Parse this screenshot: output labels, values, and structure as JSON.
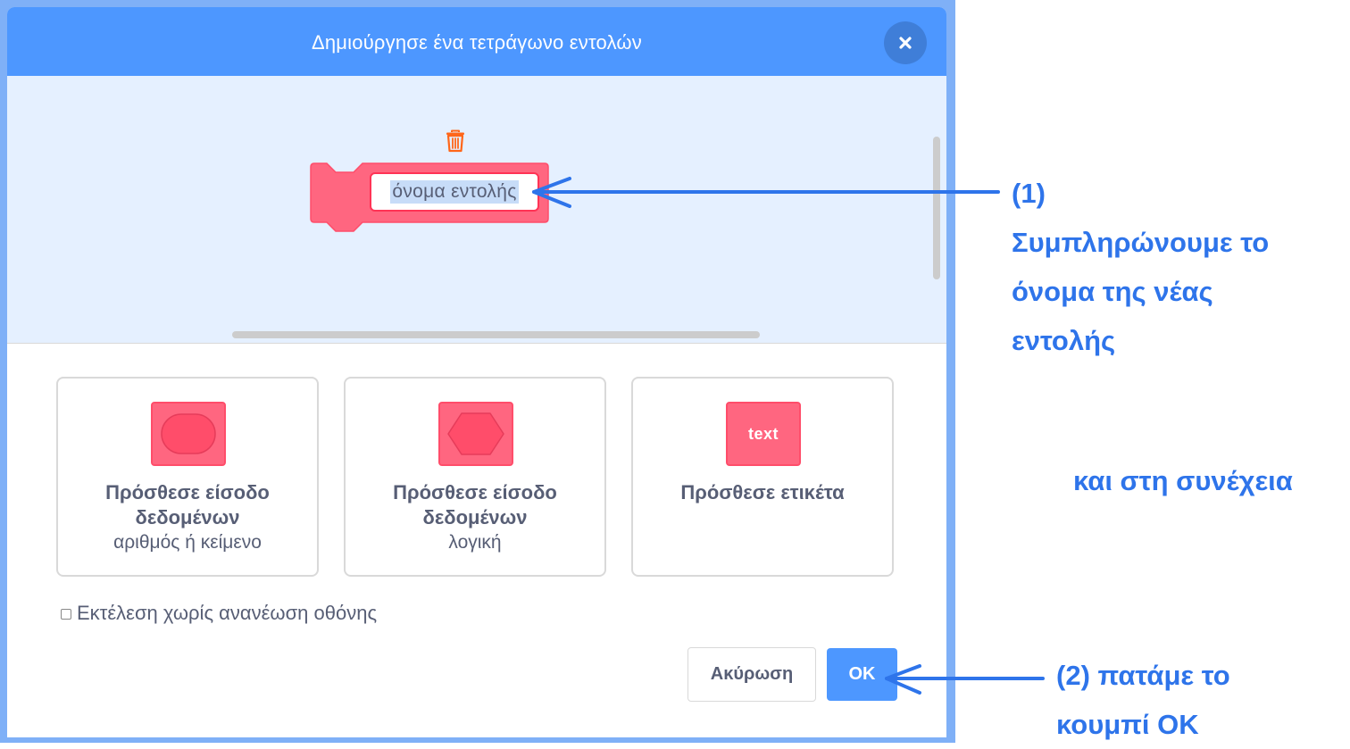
{
  "modal": {
    "title": "Δημιούργησε ένα τετράγωνο εντολών",
    "close_icon": "close-icon"
  },
  "workspace": {
    "trash_icon": "trash-icon",
    "block_name": "όνομα εντολής"
  },
  "options": [
    {
      "title": "Πρόσθεσε είσοδο δεδομένων",
      "subtitle": "αριθμός ή κείμενο",
      "icon": "oval-input-icon"
    },
    {
      "title": "Πρόσθεσε είσοδο δεδομένων",
      "subtitle": "λογική",
      "icon": "hexagon-input-icon"
    },
    {
      "title": "Πρόσθεσε ετικέτα",
      "subtitle": "",
      "icon": "text-label-icon",
      "icon_text": "text"
    }
  ],
  "checkbox": {
    "label": "Εκτέλεση χωρίς ανανέωση οθόνης",
    "checked": false
  },
  "buttons": {
    "cancel": "Ακύρωση",
    "ok": "OK"
  },
  "annotations": {
    "step1": [
      "(1)",
      "Συμπληρώνουμε το",
      "όνομα της νέας",
      "εντολής"
    ],
    "middle": "και στη συνέχεια",
    "step2": [
      "(2) πατάμε το",
      "κουμπί OK"
    ],
    "color": "#2e74ea"
  },
  "colors": {
    "header": "#4d97ff",
    "workspace": "#e5f0ff",
    "block": "#ff6680",
    "block_border": "#ff4d6a",
    "trash": "#ff661a"
  }
}
